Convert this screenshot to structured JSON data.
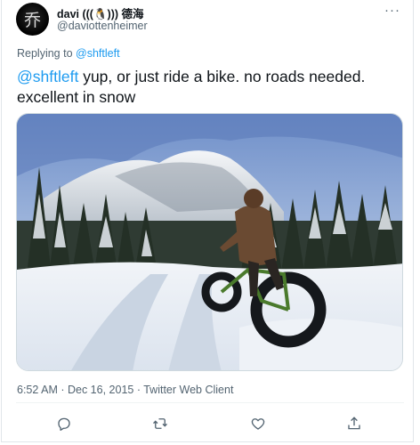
{
  "author": {
    "display_name": "davi (((🐧))) 德海",
    "handle": "@daviottenheimer",
    "avatar_glyph": "乔"
  },
  "more_label": "···",
  "reply_context": {
    "prefix": "Replying to",
    "target": "@shftleft"
  },
  "tweet": {
    "mention": "@shftleft",
    "body": " yup, or just ride a bike. no roads needed. excellent in snow"
  },
  "meta": {
    "time": "6:52 AM",
    "separator1": " · ",
    "date": "Dec 16, 2015",
    "separator2": " · ",
    "client": "Twitter Web Client"
  },
  "actions": [
    "reply-icon",
    "retweet-icon",
    "like-icon",
    "share-icon"
  ],
  "colors": {
    "accent": "#1d9bf0",
    "secondary_text": "#536471",
    "text": "#0f1419"
  }
}
